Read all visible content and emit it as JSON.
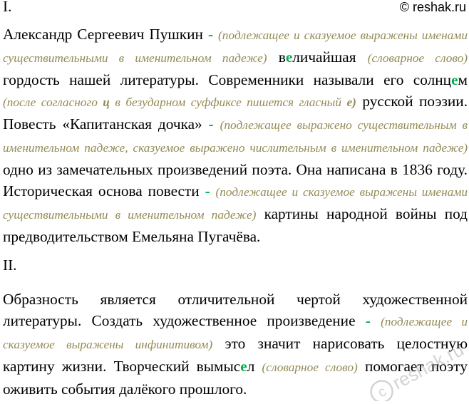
{
  "header": {
    "section_1": "I.",
    "brand": "© reshak.ru"
  },
  "colors": {
    "note": "#948a54",
    "highlight": "#00b050"
  },
  "section_1": {
    "s1": "Александр Сергеевич Пушкин",
    "dash": "-",
    "n1": "(подлежащее и сказуемое выражены именами существительными в именительном падеже)",
    "w1a": "в",
    "w1b": "е",
    "w1c": "личайшая",
    "n2": "(словарное слово)",
    "s2": "гордость нашей литературы. Современники называли его солнц",
    "w2b": "е",
    "w2c": "м",
    "n3a": "(после согласного",
    "n3b": "ц",
    "n3c": "в безударном суффиксе пишется гласный",
    "n3d": "е)",
    "s3": "русской поэзии. Повесть «Капитанская дочка»",
    "n4": "(подлежащее выражено существительным в именительном падеже, сказуемое выражено числительным в именительном падеже)",
    "s4": "одно из замечательных произведений поэта. Она написана в 1836 году. Историческая основа повести",
    "n5": "(подлежащее и сказуемое выражены именами существительными в именительном падеже)",
    "s5": "картины народной войны под предводительством Емельяна Пугачёва."
  },
  "section_2": {
    "label": "II.",
    "s1": "Образность является отличительной чертой художественной литературы. Создать художественное произведение",
    "n1": "(подлежащее и сказуемое выражены инфинитивом)",
    "s2": "это значит нарисовать целостную картину жизни. Творческий вымыс",
    "w1b": "е",
    "w1c": "л",
    "n2": "(словарное слово)",
    "s3": "помогает поэту оживить события далёкого прошлого."
  },
  "watermark": {
    "text": "reshak.ru",
    "icon": "copyright-icon"
  }
}
